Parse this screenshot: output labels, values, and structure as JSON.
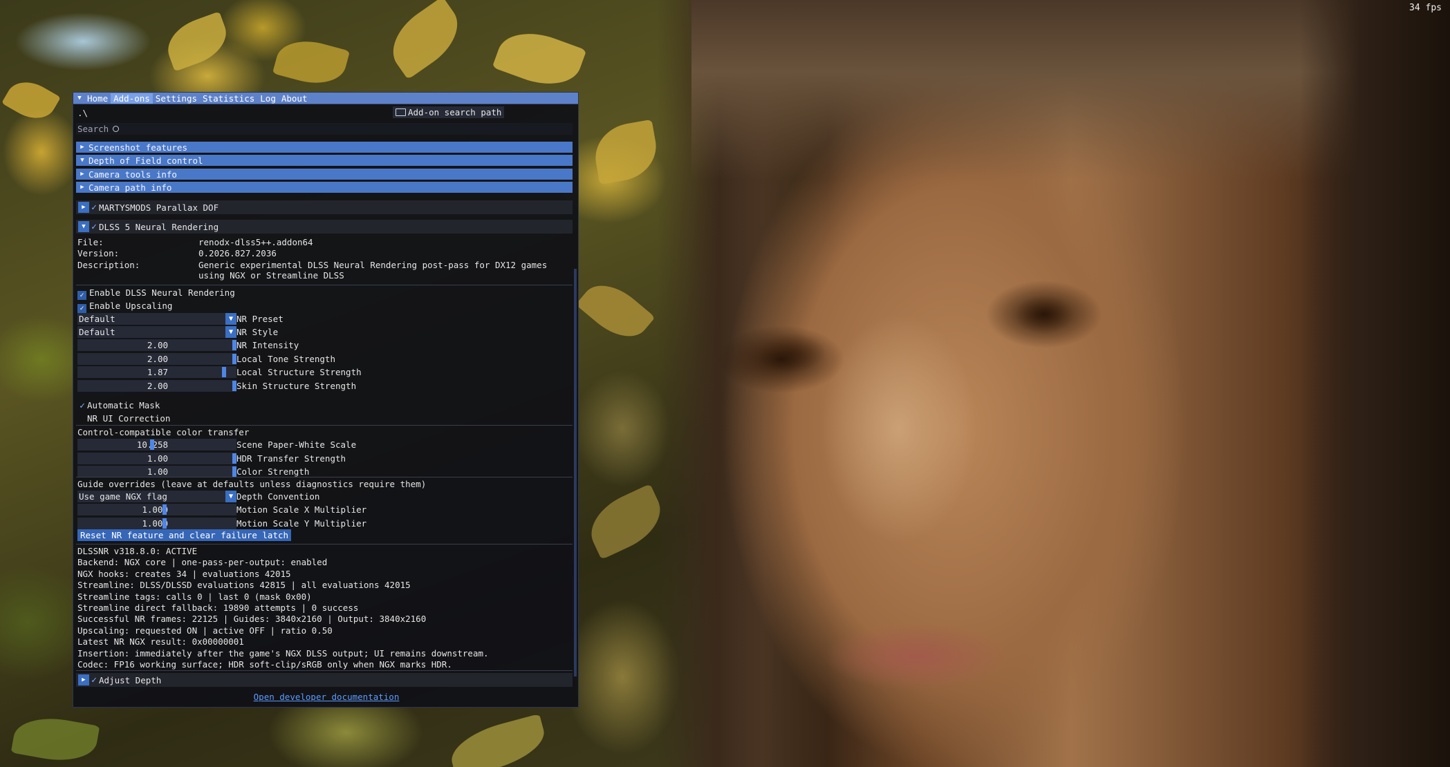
{
  "fps": "34 fps",
  "menubar": {
    "items": [
      "Home",
      "Add-ons",
      "Settings",
      "Statistics",
      "Log",
      "About"
    ],
    "active": "Add-ons"
  },
  "path_row": {
    "path": ".\\",
    "search_path_button": "Add-on search path"
  },
  "search": {
    "label": "Search"
  },
  "headers": [
    {
      "label": "Screenshot features",
      "expanded": false
    },
    {
      "label": "Depth of Field control",
      "expanded": true
    },
    {
      "label": "Camera tools info",
      "expanded": false
    },
    {
      "label": "Camera path info",
      "expanded": false
    }
  ],
  "addons": {
    "parallax": {
      "label": "MARTYSMODS Parallax DOF",
      "enabled": true
    },
    "dlss": {
      "label": "DLSS 5 Neural Rendering",
      "enabled": true
    },
    "adjust_depth": {
      "label": "Adjust Depth",
      "enabled": true
    }
  },
  "info": {
    "file_label": "File:",
    "file_value": "renodx-dlss5++.addon64",
    "version_label": "Version:",
    "version_value": "0.2026.827.2036",
    "description_label": "Description:",
    "description_line1": "Generic experimental DLSS Neural Rendering post-pass for DX12 games",
    "description_line2": "using NGX or Streamline DLSS"
  },
  "checkboxes": {
    "enable_nr": "Enable DLSS Neural Rendering",
    "enable_upscaling": "Enable Upscaling",
    "automatic_mask": "Automatic Mask",
    "nr_ui_correction": "NR UI Correction"
  },
  "nr_preset": {
    "value": "Default",
    "label": "NR Preset"
  },
  "nr_style": {
    "value": "Default",
    "label": "NR Style"
  },
  "sliders_main": [
    {
      "value": "2.00",
      "label": "NR Intensity",
      "fraction": 1.0
    },
    {
      "value": "2.00",
      "label": "Local Tone Strength",
      "fraction": 1.0
    },
    {
      "value": "1.87",
      "label": "Local Structure Strength",
      "fraction": 0.935
    },
    {
      "value": "2.00",
      "label": "Skin Structure Strength",
      "fraction": 1.0
    }
  ],
  "color_transfer": {
    "heading": "Control-compatible color transfer",
    "sliders": [
      {
        "value": "10.258",
        "label": "Scene Paper-White Scale",
        "fraction": 0.47
      },
      {
        "value": "1.00",
        "label": "HDR Transfer Strength",
        "fraction": 1.0
      },
      {
        "value": "1.00",
        "label": "Color Strength",
        "fraction": 1.0
      }
    ]
  },
  "guide_overrides": {
    "heading": "Guide overrides (leave at defaults unless diagnostics require them)",
    "depth_convention": {
      "value": "Use game NGX flag",
      "label": "Depth Convention"
    },
    "sliders": [
      {
        "value": "1.000",
        "label": "Motion Scale X Multiplier",
        "fraction": 0.55
      },
      {
        "value": "1.000",
        "label": "Motion Scale Y Multiplier",
        "fraction": 0.55
      }
    ]
  },
  "reset_button": "Reset NR feature and clear failure latch",
  "status_lines": [
    "DLSSNR v318.8.0: ACTIVE",
    "Backend: NGX core | one-pass-per-output: enabled",
    "NGX hooks: creates 34 | evaluations 42015",
    "Streamline: DLSS/DLSSD evaluations 42815 | all evaluations 42015",
    "Streamline tags: calls 0 | last 0 (mask 0x00)",
    "Streamline direct fallback: 19890 attempts | 0 success",
    "Successful NR frames: 22125 | Guides: 3840x2160 | Output: 3840x2160",
    "Upscaling: requested ON | active OFF | ratio 0.50",
    "Latest NR NGX result: 0x00000001",
    "Insertion: immediately after the game's NGX DLSS output; UI remains downstream.",
    "Codec: FP16 working surface; HDR soft-clip/sRGB only when NGX marks HDR."
  ],
  "developer_link": "Open developer documentation",
  "icons": {
    "menu": "menu-triangle-icon",
    "folder": "folder-icon",
    "search": "magnifier-icon",
    "collapsed": "arrow-right-icon",
    "expanded": "arrow-down-icon",
    "check": "checkmark-icon"
  }
}
